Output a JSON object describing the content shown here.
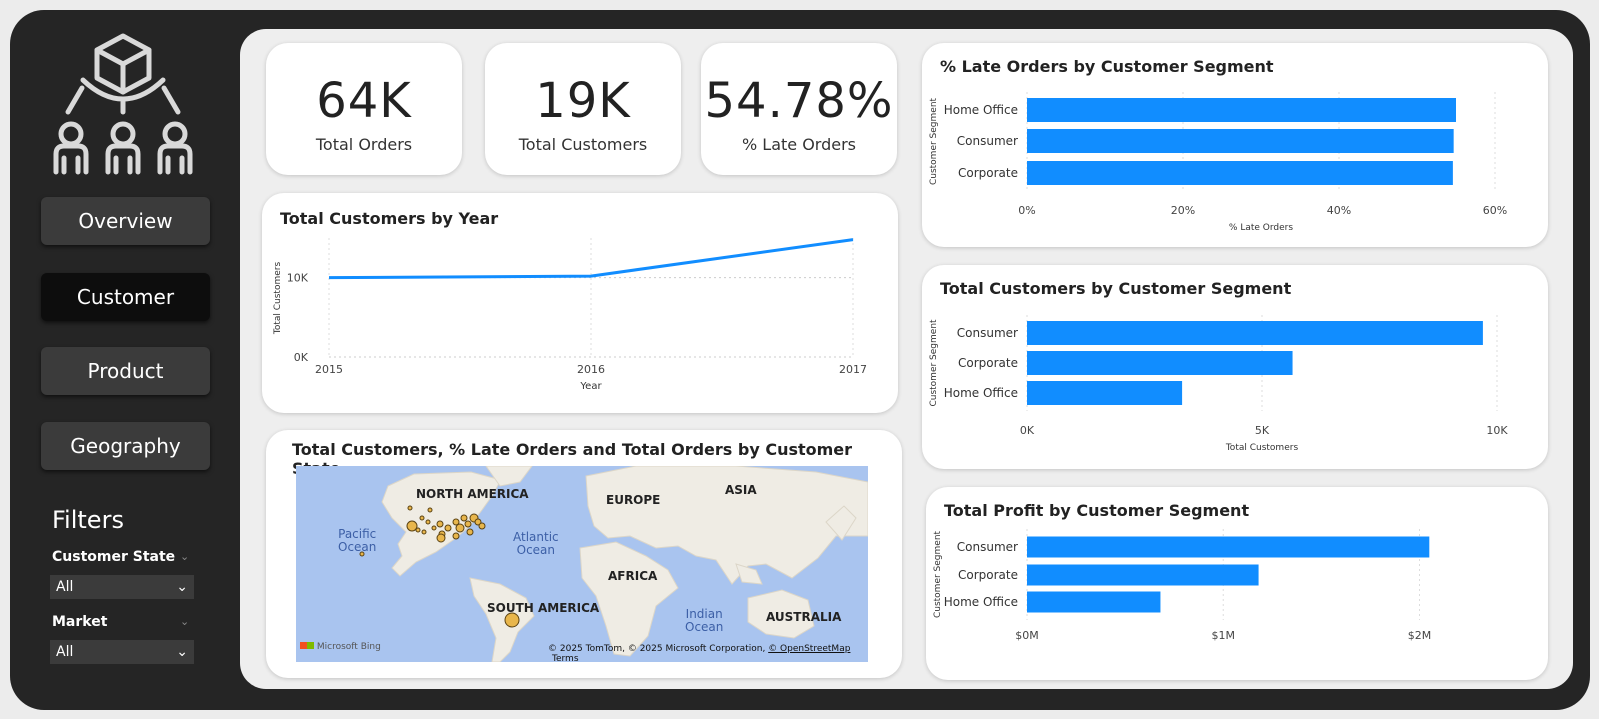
{
  "nav": {
    "items": [
      {
        "label": "Overview",
        "active": false
      },
      {
        "label": "Customer",
        "active": true
      },
      {
        "label": "Product",
        "active": false
      },
      {
        "label": "Geography",
        "active": false
      }
    ]
  },
  "filters": {
    "title": "Filters",
    "customer_state": {
      "label": "Customer State",
      "value": "All"
    },
    "market": {
      "label": "Market",
      "value": "All"
    }
  },
  "kpis": [
    {
      "value": "64K",
      "label": "Total Orders"
    },
    {
      "value": "19K",
      "label": "Total Customers"
    },
    {
      "value": "54.78%",
      "label": "% Late Orders"
    }
  ],
  "map": {
    "title": "Total Customers, % Late Orders and Total Orders by Customer State",
    "labels": {
      "north_america": "NORTH AMERICA",
      "europe": "EUROPE",
      "asia": "ASIA",
      "africa": "AFRICA",
      "south_america": "SOUTH AMERICA",
      "australia": "AUSTRALIA",
      "pacific": "Pacific\nOcean",
      "atlantic": "Atlantic\nOcean",
      "indian": "Indian\nOcean"
    },
    "attribution": "© 2025 TomTom, © 2025 Microsoft Corporation,",
    "osm": "© OpenStreetMap",
    "terms": "Terms",
    "bing": "Microsoft Bing"
  },
  "colors": {
    "accent": "#118dff",
    "sidebar": "#252525",
    "bubble": "#e8b64c"
  },
  "chart_data": [
    {
      "id": "customers_by_year",
      "type": "line",
      "title": "Total Customers by Year",
      "xlabel": "Year",
      "ylabel": "Total Customers",
      "x": [
        "2015",
        "2016",
        "2017"
      ],
      "series": [
        {
          "values": [
            10000,
            10200,
            14800
          ]
        }
      ],
      "yticks": [
        "0K",
        "10K"
      ],
      "ylim": [
        0,
        15000
      ],
      "grid": true
    },
    {
      "id": "late_orders_by_segment",
      "type": "bar",
      "title": "% Late Orders by Customer Segment",
      "ylabel": "Customer Segment",
      "xlabel": "% Late Orders",
      "categories": [
        "Home Office",
        "Consumer",
        "Corporate"
      ],
      "values": [
        55.0,
        54.7,
        54.6
      ],
      "xticks": [
        "0%",
        "20%",
        "40%",
        "60%"
      ],
      "xlim": [
        0,
        60
      ]
    },
    {
      "id": "customers_by_segment",
      "type": "bar",
      "title": "Total Customers by Customer Segment",
      "ylabel": "Customer Segment",
      "xlabel": "Total Customers",
      "categories": [
        "Consumer",
        "Corporate",
        "Home Office"
      ],
      "values": [
        9700,
        5650,
        3300
      ],
      "xticks": [
        "0K",
        "5K",
        "10K"
      ],
      "xlim": [
        0,
        10000
      ]
    },
    {
      "id": "profit_by_segment",
      "type": "bar",
      "title": "Total Profit by Customer Segment",
      "ylabel": "Customer Segment",
      "xlabel": "",
      "categories": [
        "Consumer",
        "Corporate",
        "Home Office"
      ],
      "values": [
        2.05,
        1.18,
        0.68
      ],
      "xticks": [
        "$0M",
        "$1M",
        "$2M"
      ],
      "xlim": [
        0,
        2.4
      ]
    }
  ]
}
